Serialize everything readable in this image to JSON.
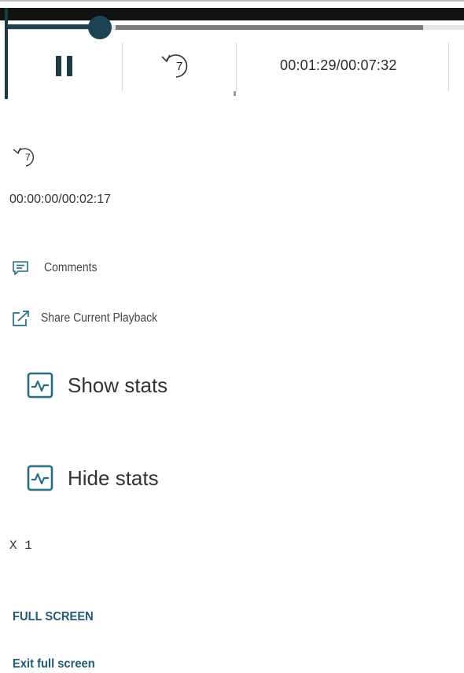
{
  "player": {
    "progress_fraction": 0.2025,
    "buffered_fraction": 0.91,
    "time_display": "00:01:29/00:07:32",
    "rewind_seconds": "7",
    "colors": {
      "accent": "#1b4452",
      "track": "#e6e6e6",
      "buffer": "#7a7a7a"
    }
  },
  "secondary": {
    "rewind_seconds": "7",
    "time_display": "00:00:00/00:02:17"
  },
  "links": {
    "comments": "Comments",
    "share": "Share Current Playback",
    "show_stats": "Show stats",
    "hide_stats": "Hide stats"
  },
  "speed": "X 1",
  "fullscreen": {
    "enter": "FULL SCREEN",
    "exit": "Exit full screen"
  },
  "icons": [
    "pause-icon",
    "rewind-7-icon",
    "comment-icon",
    "share-icon",
    "stats-icon"
  ],
  "colors": {
    "link_teal": "#1d5d73",
    "icon_teal": "#1f6f87"
  }
}
